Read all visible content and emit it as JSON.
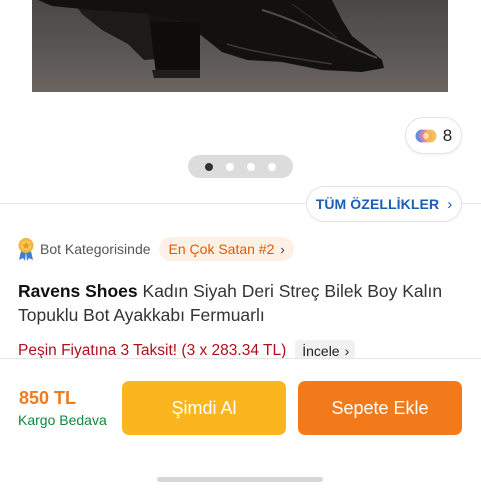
{
  "gallery": {
    "photo_count": "8",
    "pager_dots": 4,
    "active_dot": 0
  },
  "features_button": {
    "label": "TÜM ÖZELLİKLER"
  },
  "category": {
    "prefix": "Bot Kategorisinde",
    "rank_label": "En Çok Satan #2"
  },
  "product": {
    "brand": "Ravens Shoes",
    "name": "Kadın Siyah Deri Streç Bilek Boy Kalın Topuklu Bot Ayakkabı Fermuarlı"
  },
  "installment": {
    "text": "Peşin Fiyatına 3 Taksit! (3 x 283.34 TL)",
    "inspect_label": "İncele"
  },
  "bottom_bar": {
    "price": "850 TL",
    "shipping": "Kargo Bedava",
    "buy_now_label": "Şimdi Al",
    "add_to_cart_label": "Sepete Ekle"
  },
  "colors": {
    "brand_orange": "#f27a1a",
    "buy_now_yellow": "#fbb61f",
    "link_blue": "#1a5fb4",
    "installment_red": "#b0101b",
    "shipping_green": "#0b8a3c"
  },
  "icons": {
    "photo_count_icon": "color-circles-icon",
    "category_icon": "medal-icon",
    "chevron": "chevron-right-icon"
  }
}
